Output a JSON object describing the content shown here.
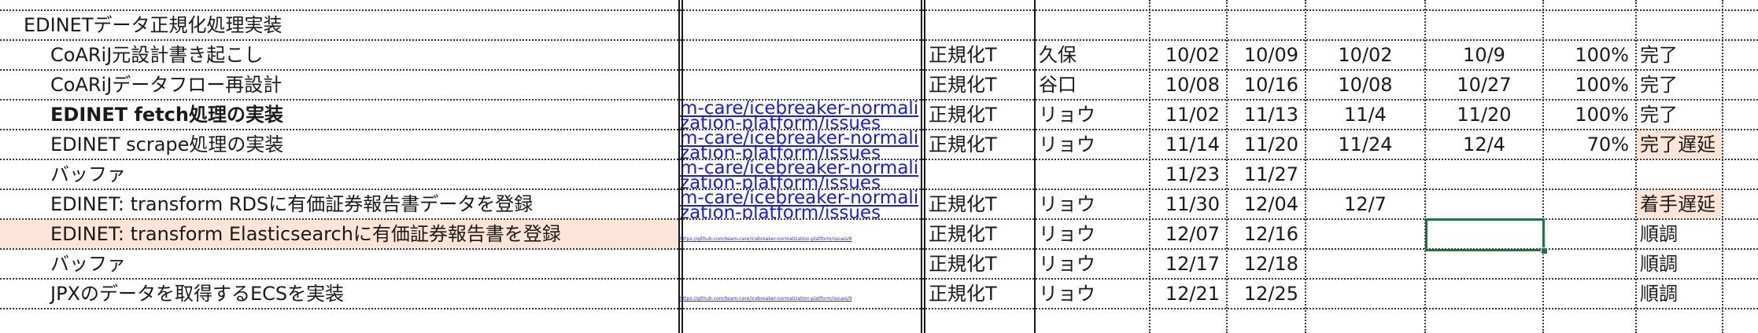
{
  "sheet": {
    "rows": [
      {
        "task": "EDINETデータ正規化処理実装",
        "indent": false,
        "bold": false,
        "highlight": false,
        "link": "",
        "link_style": "",
        "team": "",
        "owner": "",
        "plan_start": "",
        "plan_end": "",
        "actual_start": "",
        "actual_end": "",
        "progress": "",
        "status": "",
        "status_highlight": false
      },
      {
        "task": "CoARiJ元設計書き起こし",
        "indent": true,
        "bold": false,
        "highlight": false,
        "link": "",
        "link_style": "",
        "team": "正規化T",
        "owner": "久保",
        "plan_start": "10/02",
        "plan_end": "10/09",
        "actual_start": "10/02",
        "actual_end": "10/9",
        "progress": "100%",
        "status": "完了",
        "status_highlight": false
      },
      {
        "task": "CoARiJデータフロー再設計",
        "indent": true,
        "bold": false,
        "highlight": false,
        "link": "",
        "link_style": "",
        "team": "正規化T",
        "owner": "谷口",
        "plan_start": "10/08",
        "plan_end": "10/16",
        "actual_start": "10/08",
        "actual_end": "10/27",
        "progress": "100%",
        "status": "完了",
        "status_highlight": false
      },
      {
        "task": "EDINET fetch処理の実装",
        "indent": true,
        "bold": true,
        "highlight": false,
        "link": "m-care/icebreaker-normalization-platform/issues",
        "link_style": "big",
        "team": "正規化T",
        "owner": "リョウ",
        "plan_start": "11/02",
        "plan_end": "11/13",
        "actual_start": "11/4",
        "actual_end": "11/20",
        "progress": "100%",
        "status": "完了",
        "status_highlight": false
      },
      {
        "task": "EDINET scrape処理の実装",
        "indent": true,
        "bold": false,
        "highlight": false,
        "link": "m-care/icebreaker-normalization-platform/issues",
        "link_style": "big",
        "team": "正規化T",
        "owner": "リョウ",
        "plan_start": "11/14",
        "plan_end": "11/20",
        "actual_start": "11/24",
        "actual_end": "12/4",
        "progress": "70%",
        "status": "完了遅延",
        "status_highlight": true
      },
      {
        "task": "バッファ",
        "indent": true,
        "bold": false,
        "highlight": false,
        "link": "m-care/icebreaker-normalization-platform/issues",
        "link_style": "big",
        "team": "",
        "owner": "",
        "plan_start": "11/23",
        "plan_end": "11/27",
        "actual_start": "",
        "actual_end": "",
        "progress": "",
        "status": "",
        "status_highlight": false
      },
      {
        "task": "EDINET: transform RDSに有価証券報告書データを登録",
        "indent": true,
        "bold": false,
        "highlight": false,
        "link": "m-care/icebreaker-normalization-platform/issues",
        "link_style": "big",
        "team": "正規化T",
        "owner": "リョウ",
        "plan_start": "11/30",
        "plan_end": "12/04",
        "actual_start": "12/7",
        "actual_end": "",
        "progress": "",
        "status": "着手遅延",
        "status_highlight": true
      },
      {
        "task": "EDINET: transform Elasticsearchに有価証券報告書を登録",
        "indent": true,
        "bold": false,
        "highlight": true,
        "link": "https://github.com/team-care/icebreaker-normalization-platform/issues/8",
        "link_style": "tiny",
        "team": "正規化T",
        "owner": "リョウ",
        "plan_start": "12/07",
        "plan_end": "12/16",
        "actual_start": "",
        "actual_end": "",
        "progress": "",
        "status": "順調",
        "status_highlight": false
      },
      {
        "task": "バッファ",
        "indent": true,
        "bold": false,
        "highlight": false,
        "link": "",
        "link_style": "",
        "team": "正規化T",
        "owner": "リョウ",
        "plan_start": "12/17",
        "plan_end": "12/18",
        "actual_start": "",
        "actual_end": "",
        "progress": "",
        "status": "順調",
        "status_highlight": false
      },
      {
        "task": "JPXのデータを取得するECSを実装",
        "indent": true,
        "bold": false,
        "highlight": false,
        "link": "https://github.com/team-care/icebreaker-normalization-platform/issues/9",
        "link_style": "tiny",
        "team": "正規化T",
        "owner": "リョウ",
        "plan_start": "12/21",
        "plan_end": "12/25",
        "actual_start": "",
        "actual_end": "",
        "progress": "",
        "status": "順調",
        "status_highlight": false
      }
    ],
    "colors": {
      "accent_selection": "#217346",
      "status_late_bg": "#fce4d6",
      "task_highlight_bg": "#fce4d6",
      "link": "#1a1ae0"
    }
  }
}
